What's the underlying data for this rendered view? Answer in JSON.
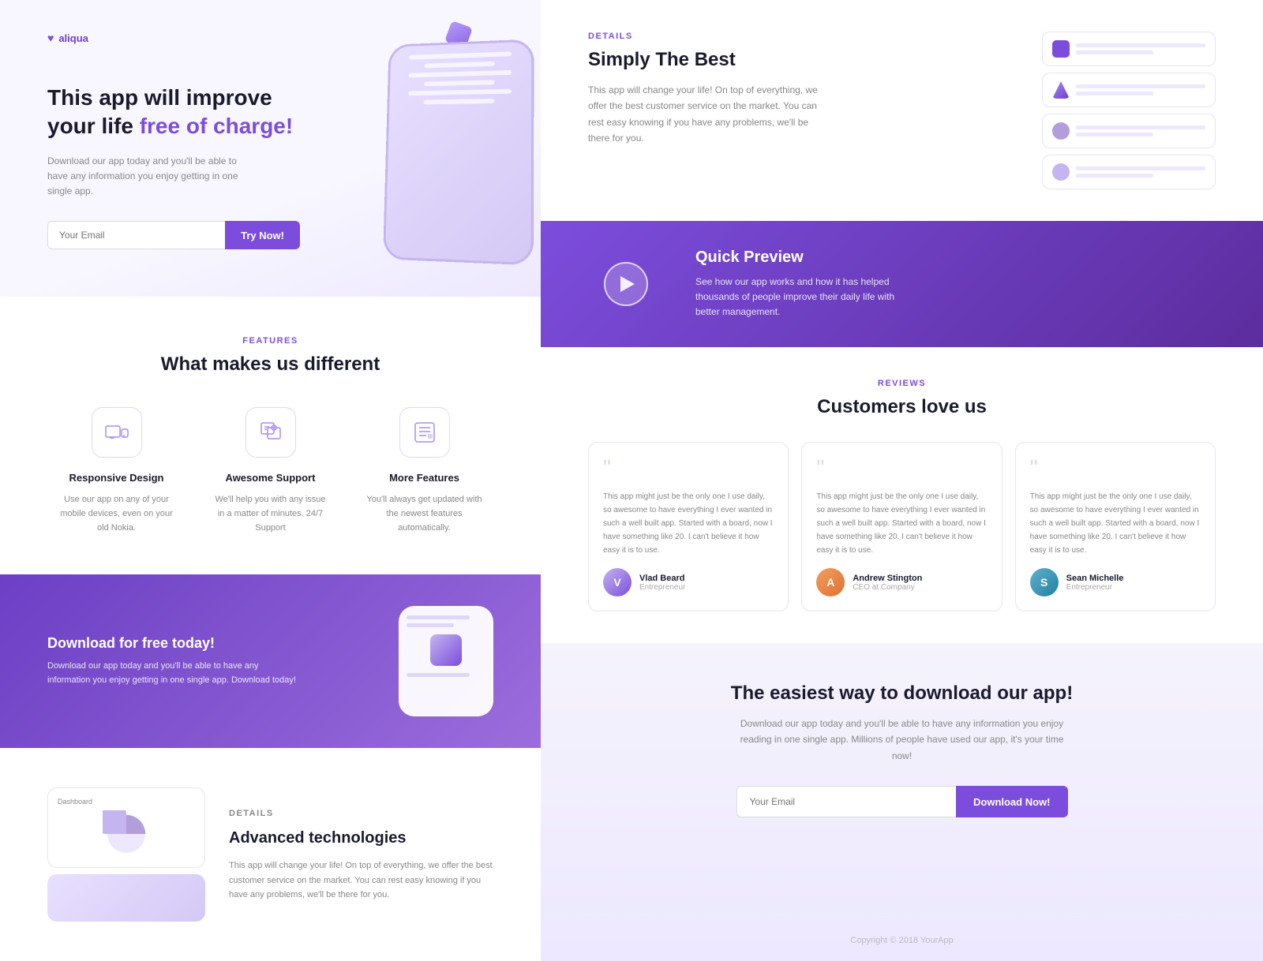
{
  "brand": {
    "name": "aliqua",
    "logo_symbol": "♥"
  },
  "hero": {
    "title_line1": "This app will improve",
    "title_line2": "your life ",
    "title_highlight": "free of charge!",
    "subtitle": "Download our app today and you'll be able to have any information you enjoy getting in one single app.",
    "email_placeholder": "Your Email",
    "try_button_label": "Try Now!"
  },
  "features": {
    "tag": "FEATURES",
    "title": "What makes us different",
    "items": [
      {
        "name": "Responsive Design",
        "desc": "Use our app on any of your mobile devices, even on your old Nokia."
      },
      {
        "name": "Awesome Support",
        "desc": "We'll help you with any issue in a matter of minutes. 24/7 Support"
      },
      {
        "name": "More Features",
        "desc": "You'll always get updated with the newest features automatically."
      }
    ]
  },
  "download_banner": {
    "title": "Download for free today!",
    "subtitle": "Download our app today and you'll be able to have any information you enjoy getting in one single app. Download today!"
  },
  "details_section": {
    "tag": "DETAILS",
    "title": "Advanced technologies",
    "desc": "This app will change your life! On top of everything, we offer the best customer service on the market. You can rest easy knowing if you have any problems, we'll be there for you."
  },
  "simply_best": {
    "tag": "DETAILS",
    "title": "Simply The Best",
    "desc": "This app will change your life! On top of everything, we offer the best customer service on the market. You can rest easy knowing if you have any problems, we'll be there for you."
  },
  "video_section": {
    "title": "Quick Preview",
    "desc": "See how our app works and how it has helped thousands of people improve their daily life with better management."
  },
  "reviews": {
    "tag": "REVIEWS",
    "title": "Customers love us",
    "items": [
      {
        "text": "This app might just be the only one I use daily, so awesome to have everything I ever wanted in such a well built app. Started with a board, now I have something like 20. I can't believe it how easy it is to use.",
        "name": "Vlad Beard",
        "role": "Entrepreneur",
        "initials": "V"
      },
      {
        "text": "This app might just be the only one I use daily, so awesome to have everything I ever wanted in such a well built app. Started with a board, now I have something like 20. I can't believe it how easy it is to use.",
        "name": "Andrew Stington",
        "role": "CEO at Company",
        "initials": "A"
      },
      {
        "text": "This app might just be the only one I use daily, so awesome to have everything I ever wanted in such a well built app. Started with a board, now I have something like 20. I can't believe it how easy it is to use.",
        "name": "Sean Michelle",
        "role": "Entrepreneur",
        "initials": "S"
      }
    ]
  },
  "bottom_cta": {
    "title": "The easiest way to download our app!",
    "desc": "Download our app today and you'll be able to have any information you enjoy reading in one single app. Millions of people have used our app, it's your time now!",
    "email_placeholder": "Your Email",
    "download_button_label": "Download Now!"
  },
  "footer": {
    "copyright": "Copyright © 2018 YourApp"
  },
  "colors": {
    "brand_purple": "#7c4ddc",
    "dark_purple": "#6c3fc5",
    "light_purple": "#a78bfa",
    "text_dark": "#1a1a2e",
    "text_muted": "#888888"
  }
}
